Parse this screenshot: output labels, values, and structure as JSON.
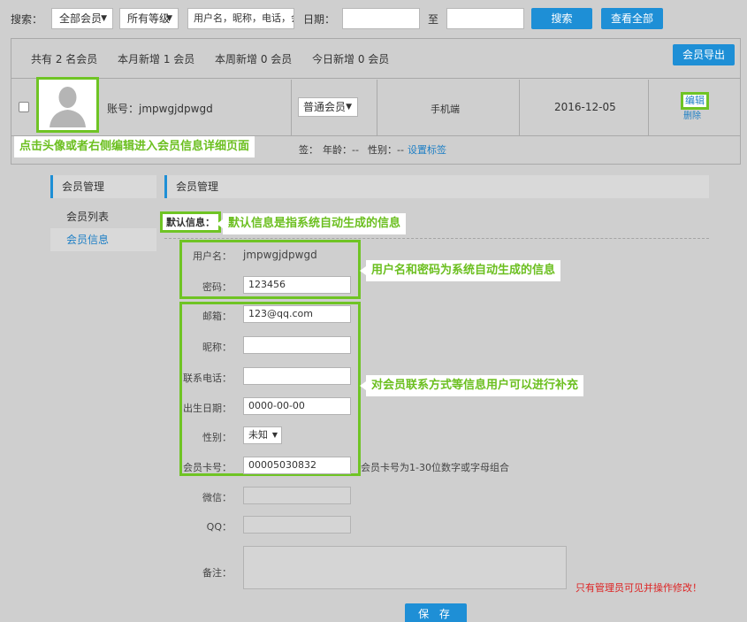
{
  "search": {
    "label": "搜索：",
    "member_type": "全部会员",
    "level": "所有等级",
    "keyword_placeholder": "用户名，昵称，电话，会",
    "date_label": "日期：",
    "to_label": "至",
    "search_button": "搜索",
    "view_all_button": "查看全部"
  },
  "stats": {
    "total": "共有 2 名会员",
    "month_new": "本月新增 1 会员",
    "week_new": "本周新增 0 会员",
    "today_new": "今日新增 0 会员",
    "export_button": "会员导出"
  },
  "member_row": {
    "account": "账号：jmpwgjdpwgd",
    "grade": "普通会员",
    "source": "手机端",
    "date": "2016-12-05",
    "edit": "编辑",
    "delete": "删除",
    "meta_tag": "签：",
    "meta_age": "年龄：--",
    "meta_gender": "性别：--",
    "set_tag": "设置标签"
  },
  "callouts": {
    "avatar_tip": "点击头像或者右侧编辑进入会员信息详细页面",
    "default_tip": "默认信息是指系统自动生成的信息",
    "account_tip": "用户名和密码为系统自动生成的信息",
    "contact_tip": "对会员联系方式等信息用户可以进行补充"
  },
  "sidebar": {
    "title": "会员管理",
    "items": [
      {
        "label": "会员列表"
      },
      {
        "label": "会员信息"
      }
    ]
  },
  "main": {
    "title": "会员管理",
    "default_info": "默认信息：",
    "form": {
      "username_label": "用户名：",
      "username_value": "jmpwgjdpwgd",
      "password_label": "密码：",
      "password_value": "123456",
      "email_label": "邮箱：",
      "email_value": "123@qq.com",
      "nickname_label": "昵称：",
      "nickname_value": "",
      "phone_label": "联系电话：",
      "phone_value": "",
      "birthday_label": "出生日期：",
      "birthday_value": "0000-00-00",
      "gender_label": "性别：",
      "gender_value": "未知",
      "card_label": "会员卡号：",
      "card_value": "00005030832",
      "card_hint": "会员卡号为1-30位数字或字母组合",
      "wechat_label": "微信：",
      "qq_label": "QQ：",
      "remark_label": "备注：",
      "remark_hint": "只有管理员可见并操作修改！",
      "save_button": "保 存"
    }
  }
}
